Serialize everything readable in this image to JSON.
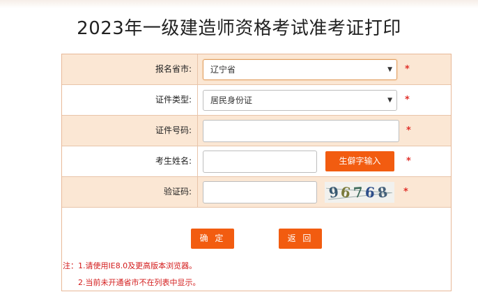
{
  "title": "2023年一级建造师资格考试准考证打印",
  "form": {
    "province": {
      "label": "报名省市:",
      "value": "辽宁省"
    },
    "id_type": {
      "label": "证件类型:",
      "value": "居民身份证"
    },
    "id_number": {
      "label": "证件号码:",
      "value": ""
    },
    "name": {
      "label": "考生姓名:",
      "value": "",
      "rare_char_button": "生僻字输入"
    },
    "captcha": {
      "label": "验证码:",
      "value": "",
      "image_text": "96768"
    },
    "required_mark": "*"
  },
  "buttons": {
    "confirm": "确 定",
    "back": "返 回"
  },
  "notes": {
    "line1": "注：1.请使用IE8.0及更高版本浏览器。",
    "line2": "2.当前未开通省市不在列表中显示。"
  },
  "colors": {
    "accent": "#f25c10",
    "row_shade": "#fbe7d4",
    "border": "#e8b897",
    "note_red": "#d31b1b"
  }
}
